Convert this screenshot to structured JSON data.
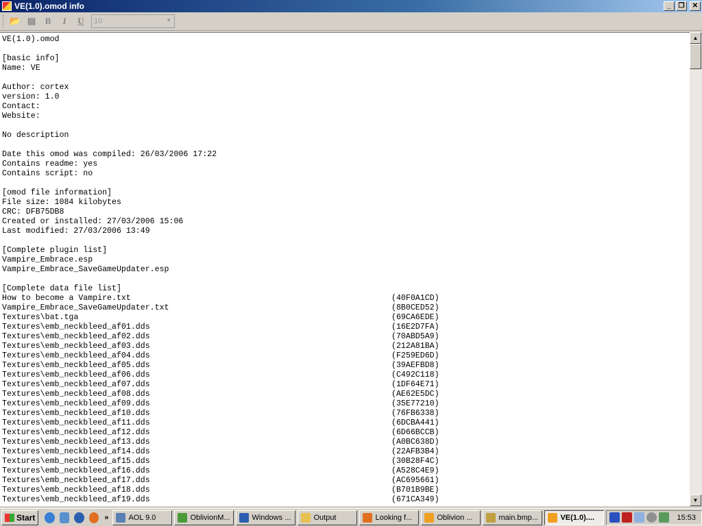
{
  "window": {
    "title": "VE(1.0).omod info",
    "minimize": "_",
    "restore": "❐",
    "close": "✕"
  },
  "toolbar": {
    "open": "📂",
    "doc": "▤",
    "bold": "B",
    "italic": "I",
    "underline": "U",
    "font_size": "10",
    "arrow": "▼"
  },
  "content": {
    "header_lines": [
      "VE(1.0).omod",
      "",
      "[basic info]",
      "Name: VE",
      "",
      "Author: cortex",
      "version: 1.0",
      "Contact:",
      "Website:",
      "",
      "No description",
      "",
      "Date this omod was compiled: 26/03/2006 17:22",
      "Contains readme: yes",
      "Contains script: no",
      "",
      "[omod file information]",
      "File size: 1084 kilobytes",
      "CRC: DFB75DB8",
      "Created or installed: 27/03/2006 15:06",
      "Last modified: 27/03/2006 13:49",
      "",
      "[Complete plugin list]",
      "Vampire_Embrace.esp",
      "Vampire_Embrace_SaveGameUpdater.esp",
      "",
      "[Complete data file list]"
    ],
    "files": [
      {
        "name": "How to become a Vampire.txt",
        "crc": "(40F0A1CD)"
      },
      {
        "name": "Vampire_Embrace_SaveGameUpdater.txt",
        "crc": "(8B0CED52)"
      },
      {
        "name": "Textures\\bat.tga",
        "crc": "(69CA6EDE)"
      },
      {
        "name": "Textures\\emb_neckbleed_af01.dds",
        "crc": "(16E2D7FA)"
      },
      {
        "name": "Textures\\emb_neckbleed_af02.dds",
        "crc": "(70ABD5A9)"
      },
      {
        "name": "Textures\\emb_neckbleed_af03.dds",
        "crc": "(212A81BA)"
      },
      {
        "name": "Textures\\emb_neckbleed_af04.dds",
        "crc": "(F259ED6D)"
      },
      {
        "name": "Textures\\emb_neckbleed_af05.dds",
        "crc": "(39AEFBD8)"
      },
      {
        "name": "Textures\\emb_neckbleed_af06.dds",
        "crc": "(C492C118)"
      },
      {
        "name": "Textures\\emb_neckbleed_af07.dds",
        "crc": "(1DF64E71)"
      },
      {
        "name": "Textures\\emb_neckbleed_af08.dds",
        "crc": "(AE62E5DC)"
      },
      {
        "name": "Textures\\emb_neckbleed_af09.dds",
        "crc": "(35E77210)"
      },
      {
        "name": "Textures\\emb_neckbleed_af10.dds",
        "crc": "(76FB6338)"
      },
      {
        "name": "Textures\\emb_neckbleed_af11.dds",
        "crc": "(6DCBA441)"
      },
      {
        "name": "Textures\\emb_neckbleed_af12.dds",
        "crc": "(6D66BCCB)"
      },
      {
        "name": "Textures\\emb_neckbleed_af13.dds",
        "crc": "(A0BC638D)"
      },
      {
        "name": "Textures\\emb_neckbleed_af14.dds",
        "crc": "(22AFB3B4)"
      },
      {
        "name": "Textures\\emb_neckbleed_af15.dds",
        "crc": "(30B28F4C)"
      },
      {
        "name": "Textures\\emb_neckbleed_af16.dds",
        "crc": "(A528C4E9)"
      },
      {
        "name": "Textures\\emb_neckbleed_af17.dds",
        "crc": "(AC695661)"
      },
      {
        "name": "Textures\\emb_neckbleed_af18.dds",
        "crc": "(B701B9BE)"
      },
      {
        "name": "Textures\\emb_neckbleed_af19.dds",
        "crc": "(671CA349)"
      }
    ]
  },
  "scrollbar": {
    "up": "▲",
    "down": "▼"
  },
  "taskbar": {
    "start": "Start",
    "more": "»",
    "tasks": [
      {
        "label": "AOL 9.0",
        "color": "#5a7fb5"
      },
      {
        "label": "OblivionM...",
        "color": "#4a9a3a"
      },
      {
        "label": "Windows ...",
        "color": "#2a5fb0"
      },
      {
        "label": "Output",
        "color": "#e8c050"
      },
      {
        "label": "Looking f...",
        "color": "#e07020"
      },
      {
        "label": "Oblivion ...",
        "color": "#f0a020"
      },
      {
        "label": "main.bmp...",
        "color": "#c0a040"
      },
      {
        "label": "VE(1.0)....",
        "color": "#f0a020"
      }
    ],
    "clock": "15:53"
  }
}
